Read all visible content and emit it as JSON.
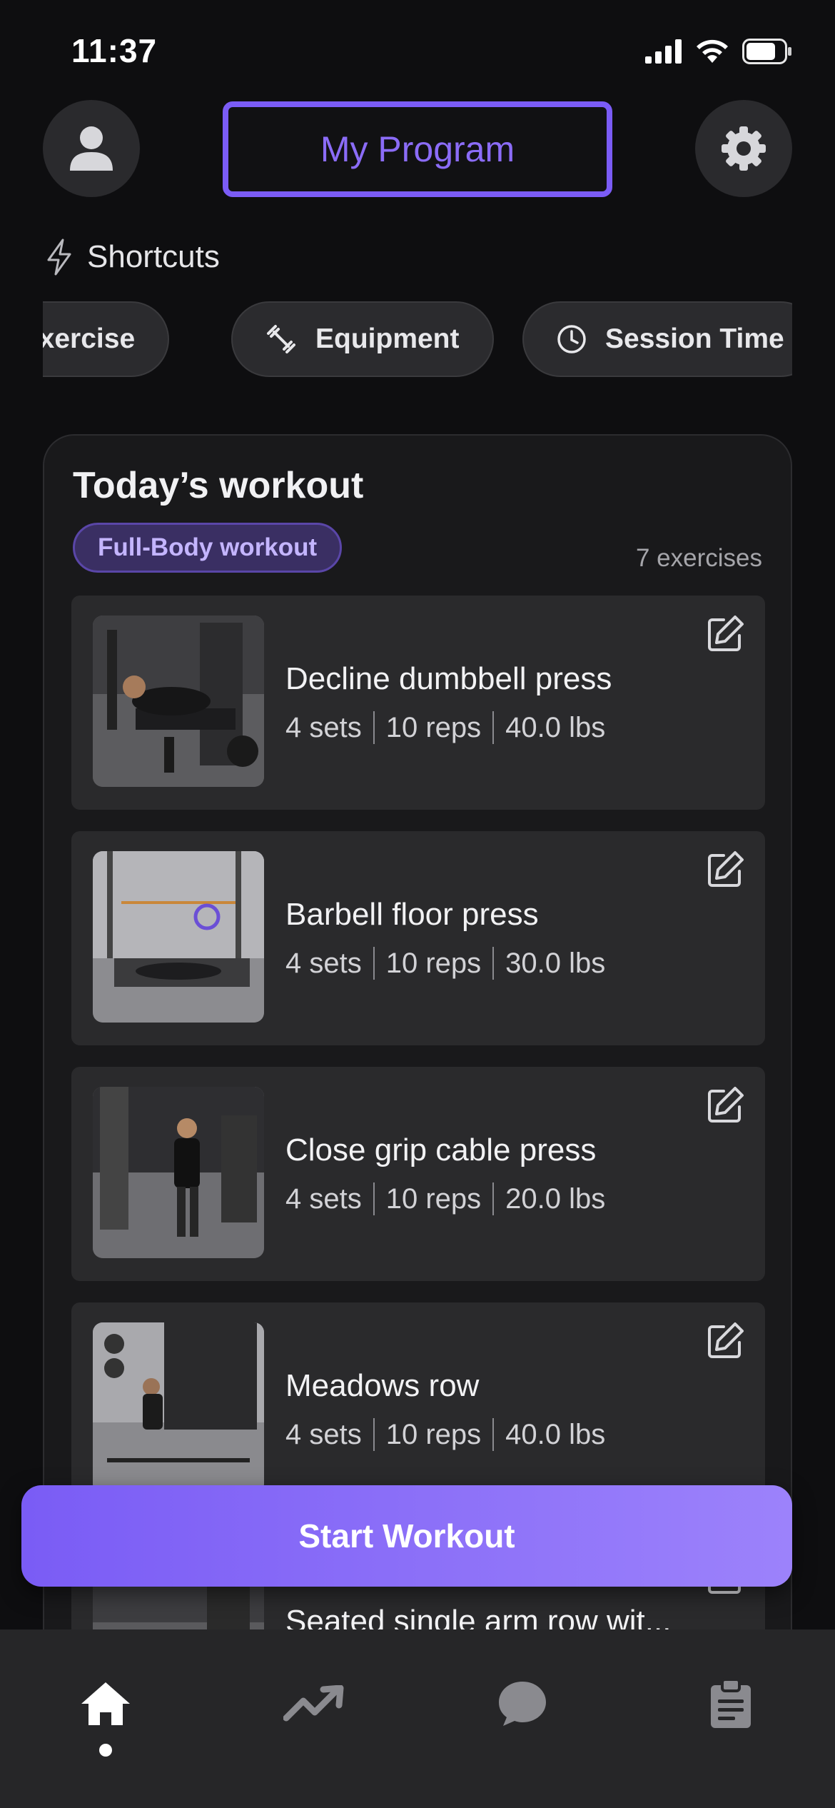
{
  "status_bar": {
    "time": "11:37"
  },
  "header": {
    "program_label": "My Program"
  },
  "shortcuts": {
    "heading": "Shortcuts",
    "items": [
      {
        "label": "d Exercise",
        "icon": "none"
      },
      {
        "label": "Equipment",
        "icon": "dumbbell-icon"
      },
      {
        "label": "Session Time",
        "icon": "clock-icon"
      }
    ]
  },
  "workout": {
    "title": "Today’s workout",
    "badge": "Full-Body workout",
    "count": "7 exercises",
    "exercises": [
      {
        "name": "Decline dumbbell press",
        "sets": "4 sets",
        "reps": "10 reps",
        "weight": "40.0 lbs"
      },
      {
        "name": "Barbell floor press",
        "sets": "4 sets",
        "reps": "10 reps",
        "weight": "30.0 lbs"
      },
      {
        "name": "Close grip cable press",
        "sets": "4 sets",
        "reps": "10 reps",
        "weight": "20.0 lbs"
      },
      {
        "name": "Meadows row",
        "sets": "4 sets",
        "reps": "10 reps",
        "weight": "40.0 lbs"
      },
      {
        "name": "Seated single arm row wit...",
        "sets": "",
        "reps": "",
        "weight": ""
      }
    ]
  },
  "start_button": {
    "label": "Start Workout"
  },
  "tabs": [
    {
      "name": "home",
      "icon": "home-icon",
      "active": true
    },
    {
      "name": "progress",
      "icon": "trending-up-icon",
      "active": false
    },
    {
      "name": "chat",
      "icon": "chat-bubble-icon",
      "active": false
    },
    {
      "name": "log",
      "icon": "clipboard-icon",
      "active": false
    }
  ],
  "colors": {
    "accent": "#7b5cf6",
    "background": "#0e0e10",
    "card": "#19191b",
    "row": "#2a2a2c"
  }
}
